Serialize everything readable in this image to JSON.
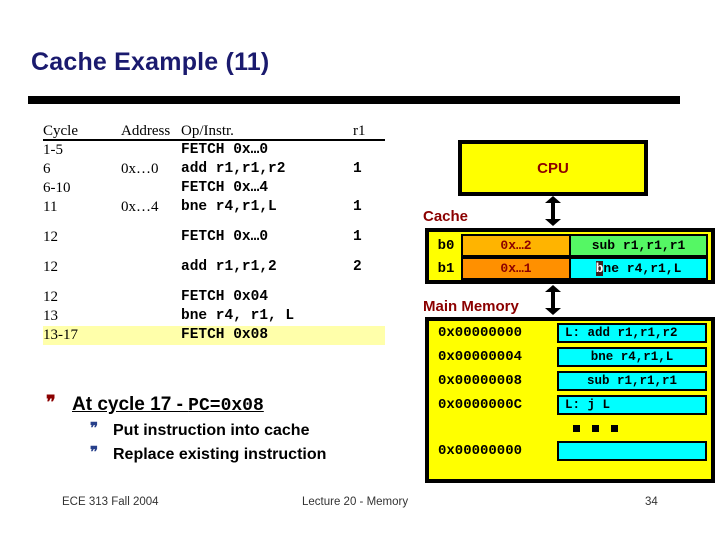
{
  "slide": {
    "title": "Cache Example (11)"
  },
  "trace_table": {
    "headers": {
      "cycle": "Cycle",
      "address": "Address",
      "op": "Op/Instr.",
      "r1": "r1"
    },
    "rows": [
      {
        "cycle": "1-5",
        "address": "",
        "op": "FETCH 0x…0",
        "r1": "",
        "highlight": false
      },
      {
        "cycle": "6",
        "address": "0x…0",
        "op": "add r1,r1,r2",
        "r1": "1",
        "highlight": false
      },
      {
        "cycle": "6-10",
        "address": "",
        "op": "FETCH 0x…4",
        "r1": "",
        "highlight": false
      },
      {
        "cycle": "11",
        "address": "0x…4",
        "op": "bne r4,r1,L",
        "r1": "1",
        "highlight": false
      },
      {
        "cycle": "12",
        "address": "",
        "op": "FETCH 0x…0",
        "r1": "1",
        "highlight": false
      },
      {
        "cycle": "12",
        "address": "",
        "op": "add r1,r1,2",
        "r1": "2",
        "highlight": false
      },
      {
        "cycle": "12",
        "address": "",
        "op": "FETCH 0x04",
        "r1": "",
        "highlight": false
      },
      {
        "cycle": "13",
        "address": "",
        "op": "bne r4, r1, L",
        "r1": "",
        "highlight": false
      },
      {
        "cycle": "13-17",
        "address": "",
        "op": "FETCH 0x08",
        "r1": "",
        "highlight": true
      }
    ]
  },
  "bullets": {
    "main_prefix": "At cycle 17 - ",
    "main_mono": "PC=0x08",
    "sub": [
      "Put instruction into cache",
      "Replace existing instruction"
    ]
  },
  "diagram": {
    "cpu_label": "CPU",
    "cache_label": "Cache",
    "memory_label": "Main Memory",
    "cache_rows": [
      {
        "block": "b0",
        "tag": "0x…2",
        "data": "sub r1,r1,r1",
        "tag_color": "#ffb400",
        "data_color": "#55f764",
        "selected_prefix": ""
      },
      {
        "block": "b1",
        "tag": "0x…1",
        "data": "ne r4,r1,L",
        "tag_color": "#ff9000",
        "data_color": "#00ffff",
        "selected_prefix": "b"
      }
    ],
    "memory_rows": [
      {
        "address": "0x00000000",
        "value": "L: add r1,r1,r2",
        "align": "left"
      },
      {
        "address": "0x00000004",
        "value": "bne r4,r1,L",
        "align": "center"
      },
      {
        "address": "0x00000008",
        "value": "sub r1,r1,r1",
        "align": "center"
      },
      {
        "address": "0x0000000C",
        "value": "L: j L",
        "align": "left"
      }
    ],
    "memory_last_row": {
      "address": "0x00000000",
      "value": ""
    }
  },
  "footer": {
    "left": "ECE 313 Fall 2004",
    "center": "Lecture 20 - Memory",
    "right": "34"
  },
  "colors": {
    "title": "#1a1a6e",
    "accent_red": "#8b0000",
    "yellow": "#ffff00",
    "cyan": "#00ffff",
    "highlight": "#ffffaa"
  }
}
